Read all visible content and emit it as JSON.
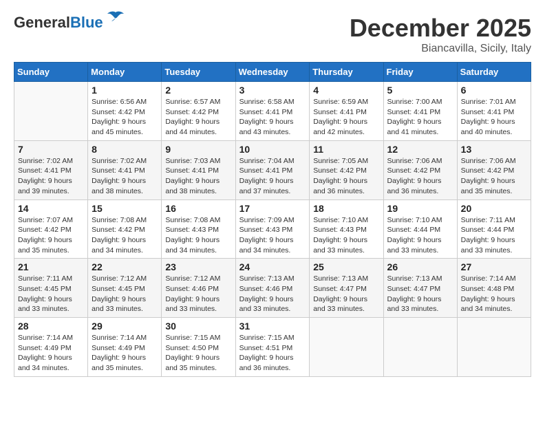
{
  "header": {
    "logo_general": "General",
    "logo_blue": "Blue",
    "month": "December 2025",
    "location": "Biancavilla, Sicily, Italy"
  },
  "weekdays": [
    "Sunday",
    "Monday",
    "Tuesday",
    "Wednesday",
    "Thursday",
    "Friday",
    "Saturday"
  ],
  "weeks": [
    [
      {
        "day": "",
        "sunrise": "",
        "sunset": "",
        "daylight": ""
      },
      {
        "day": "1",
        "sunrise": "Sunrise: 6:56 AM",
        "sunset": "Sunset: 4:42 PM",
        "daylight": "Daylight: 9 hours and 45 minutes."
      },
      {
        "day": "2",
        "sunrise": "Sunrise: 6:57 AM",
        "sunset": "Sunset: 4:42 PM",
        "daylight": "Daylight: 9 hours and 44 minutes."
      },
      {
        "day": "3",
        "sunrise": "Sunrise: 6:58 AM",
        "sunset": "Sunset: 4:41 PM",
        "daylight": "Daylight: 9 hours and 43 minutes."
      },
      {
        "day": "4",
        "sunrise": "Sunrise: 6:59 AM",
        "sunset": "Sunset: 4:41 PM",
        "daylight": "Daylight: 9 hours and 42 minutes."
      },
      {
        "day": "5",
        "sunrise": "Sunrise: 7:00 AM",
        "sunset": "Sunset: 4:41 PM",
        "daylight": "Daylight: 9 hours and 41 minutes."
      },
      {
        "day": "6",
        "sunrise": "Sunrise: 7:01 AM",
        "sunset": "Sunset: 4:41 PM",
        "daylight": "Daylight: 9 hours and 40 minutes."
      }
    ],
    [
      {
        "day": "7",
        "sunrise": "Sunrise: 7:02 AM",
        "sunset": "Sunset: 4:41 PM",
        "daylight": "Daylight: 9 hours and 39 minutes."
      },
      {
        "day": "8",
        "sunrise": "Sunrise: 7:02 AM",
        "sunset": "Sunset: 4:41 PM",
        "daylight": "Daylight: 9 hours and 38 minutes."
      },
      {
        "day": "9",
        "sunrise": "Sunrise: 7:03 AM",
        "sunset": "Sunset: 4:41 PM",
        "daylight": "Daylight: 9 hours and 38 minutes."
      },
      {
        "day": "10",
        "sunrise": "Sunrise: 7:04 AM",
        "sunset": "Sunset: 4:41 PM",
        "daylight": "Daylight: 9 hours and 37 minutes."
      },
      {
        "day": "11",
        "sunrise": "Sunrise: 7:05 AM",
        "sunset": "Sunset: 4:42 PM",
        "daylight": "Daylight: 9 hours and 36 minutes."
      },
      {
        "day": "12",
        "sunrise": "Sunrise: 7:06 AM",
        "sunset": "Sunset: 4:42 PM",
        "daylight": "Daylight: 9 hours and 36 minutes."
      },
      {
        "day": "13",
        "sunrise": "Sunrise: 7:06 AM",
        "sunset": "Sunset: 4:42 PM",
        "daylight": "Daylight: 9 hours and 35 minutes."
      }
    ],
    [
      {
        "day": "14",
        "sunrise": "Sunrise: 7:07 AM",
        "sunset": "Sunset: 4:42 PM",
        "daylight": "Daylight: 9 hours and 35 minutes."
      },
      {
        "day": "15",
        "sunrise": "Sunrise: 7:08 AM",
        "sunset": "Sunset: 4:42 PM",
        "daylight": "Daylight: 9 hours and 34 minutes."
      },
      {
        "day": "16",
        "sunrise": "Sunrise: 7:08 AM",
        "sunset": "Sunset: 4:43 PM",
        "daylight": "Daylight: 9 hours and 34 minutes."
      },
      {
        "day": "17",
        "sunrise": "Sunrise: 7:09 AM",
        "sunset": "Sunset: 4:43 PM",
        "daylight": "Daylight: 9 hours and 34 minutes."
      },
      {
        "day": "18",
        "sunrise": "Sunrise: 7:10 AM",
        "sunset": "Sunset: 4:43 PM",
        "daylight": "Daylight: 9 hours and 33 minutes."
      },
      {
        "day": "19",
        "sunrise": "Sunrise: 7:10 AM",
        "sunset": "Sunset: 4:44 PM",
        "daylight": "Daylight: 9 hours and 33 minutes."
      },
      {
        "day": "20",
        "sunrise": "Sunrise: 7:11 AM",
        "sunset": "Sunset: 4:44 PM",
        "daylight": "Daylight: 9 hours and 33 minutes."
      }
    ],
    [
      {
        "day": "21",
        "sunrise": "Sunrise: 7:11 AM",
        "sunset": "Sunset: 4:45 PM",
        "daylight": "Daylight: 9 hours and 33 minutes."
      },
      {
        "day": "22",
        "sunrise": "Sunrise: 7:12 AM",
        "sunset": "Sunset: 4:45 PM",
        "daylight": "Daylight: 9 hours and 33 minutes."
      },
      {
        "day": "23",
        "sunrise": "Sunrise: 7:12 AM",
        "sunset": "Sunset: 4:46 PM",
        "daylight": "Daylight: 9 hours and 33 minutes."
      },
      {
        "day": "24",
        "sunrise": "Sunrise: 7:13 AM",
        "sunset": "Sunset: 4:46 PM",
        "daylight": "Daylight: 9 hours and 33 minutes."
      },
      {
        "day": "25",
        "sunrise": "Sunrise: 7:13 AM",
        "sunset": "Sunset: 4:47 PM",
        "daylight": "Daylight: 9 hours and 33 minutes."
      },
      {
        "day": "26",
        "sunrise": "Sunrise: 7:13 AM",
        "sunset": "Sunset: 4:47 PM",
        "daylight": "Daylight: 9 hours and 33 minutes."
      },
      {
        "day": "27",
        "sunrise": "Sunrise: 7:14 AM",
        "sunset": "Sunset: 4:48 PM",
        "daylight": "Daylight: 9 hours and 34 minutes."
      }
    ],
    [
      {
        "day": "28",
        "sunrise": "Sunrise: 7:14 AM",
        "sunset": "Sunset: 4:49 PM",
        "daylight": "Daylight: 9 hours and 34 minutes."
      },
      {
        "day": "29",
        "sunrise": "Sunrise: 7:14 AM",
        "sunset": "Sunset: 4:49 PM",
        "daylight": "Daylight: 9 hours and 35 minutes."
      },
      {
        "day": "30",
        "sunrise": "Sunrise: 7:15 AM",
        "sunset": "Sunset: 4:50 PM",
        "daylight": "Daylight: 9 hours and 35 minutes."
      },
      {
        "day": "31",
        "sunrise": "Sunrise: 7:15 AM",
        "sunset": "Sunset: 4:51 PM",
        "daylight": "Daylight: 9 hours and 36 minutes."
      },
      {
        "day": "",
        "sunrise": "",
        "sunset": "",
        "daylight": ""
      },
      {
        "day": "",
        "sunrise": "",
        "sunset": "",
        "daylight": ""
      },
      {
        "day": "",
        "sunrise": "",
        "sunset": "",
        "daylight": ""
      }
    ]
  ]
}
